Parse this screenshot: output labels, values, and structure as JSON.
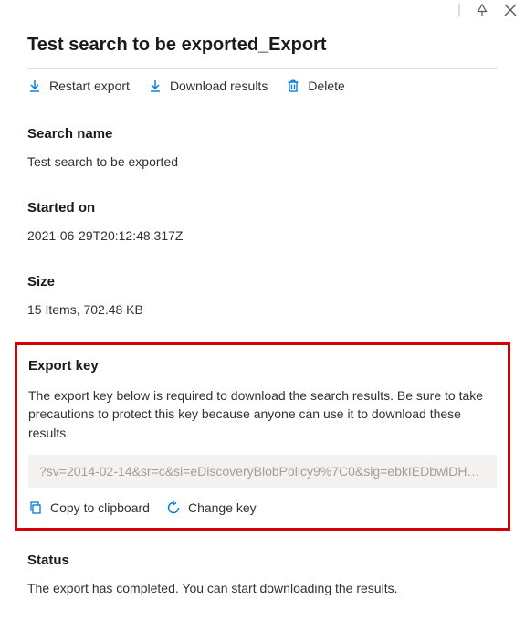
{
  "title": "Test search to be exported_Export",
  "toolbar": {
    "restart": "Restart export",
    "download": "Download results",
    "delete": "Delete"
  },
  "searchName": {
    "label": "Search name",
    "value": "Test search to be exported"
  },
  "startedOn": {
    "label": "Started on",
    "value": "2021-06-29T20:12:48.317Z"
  },
  "size": {
    "label": "Size",
    "value": "15 Items, 702.48 KB"
  },
  "exportKey": {
    "label": "Export key",
    "description": "The export key below is required to download the search results. Be sure to take precautions to protect this key because anyone can use it to download these results.",
    "value": "?sv=2014-02-14&sr=c&si=eDiscoveryBlobPolicy9%7C0&sig=ebkIEDbwiDHyi0...",
    "copyLabel": "Copy to clipboard",
    "changeLabel": "Change key"
  },
  "status": {
    "label": "Status",
    "value": "The export has completed. You can start downloading the results."
  }
}
